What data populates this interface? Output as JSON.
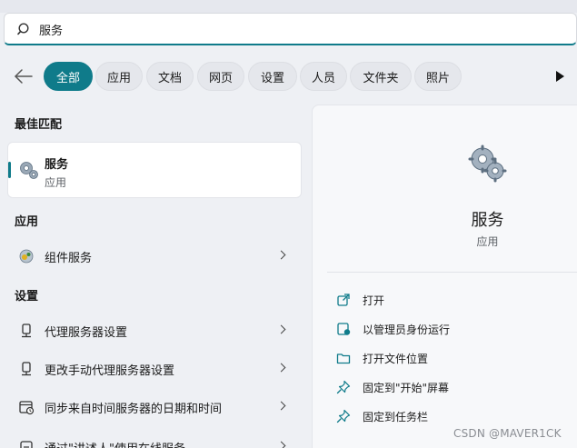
{
  "search": {
    "value": "服务"
  },
  "filters": [
    {
      "label": "全部",
      "active": true
    },
    {
      "label": "应用"
    },
    {
      "label": "文档"
    },
    {
      "label": "网页"
    },
    {
      "label": "设置"
    },
    {
      "label": "人员"
    },
    {
      "label": "文件夹"
    },
    {
      "label": "照片"
    }
  ],
  "best_match": {
    "section": "最佳匹配",
    "name": "服务",
    "type": "应用"
  },
  "apps": {
    "section": "应用",
    "items": [
      {
        "label": "组件服务"
      }
    ]
  },
  "settings": {
    "section": "设置",
    "items": [
      {
        "label": "代理服务器设置"
      },
      {
        "label": "更改手动代理服务器设置"
      },
      {
        "label": "同步来自时间服务器的日期和时间"
      },
      {
        "label": "通过\"讲述人\"使用在线服务"
      }
    ]
  },
  "preview": {
    "title": "服务",
    "subtitle": "应用",
    "actions": [
      {
        "label": "打开",
        "icon": "open-external-icon"
      },
      {
        "label": "以管理员身份运行",
        "icon": "admin-shield-icon"
      },
      {
        "label": "打开文件位置",
        "icon": "folder-icon"
      },
      {
        "label": "固定到\"开始\"屏幕",
        "icon": "pin-icon"
      },
      {
        "label": "固定到任务栏",
        "icon": "pin-icon"
      }
    ]
  },
  "watermark": "CSDN @MAVER1CK",
  "colors": {
    "accent": "#0f7b8a"
  }
}
